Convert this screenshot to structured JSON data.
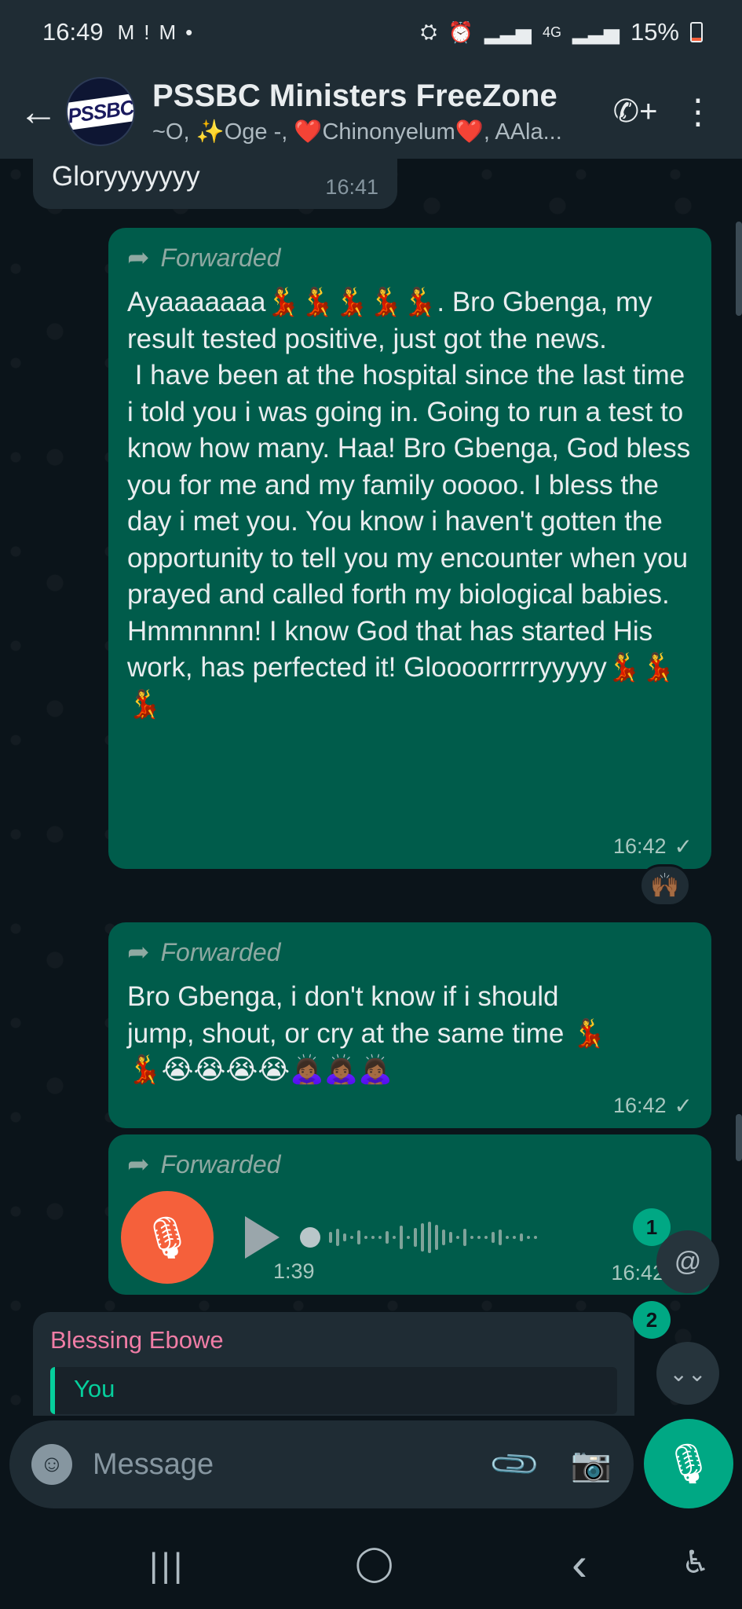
{
  "status_bar": {
    "time": "16:49",
    "left_icons": [
      "M",
      "!",
      "M",
      "•"
    ],
    "signal_label": "4G",
    "battery": "15%"
  },
  "header": {
    "back_icon": "←",
    "avatar_text": "PSSBC",
    "title": "PSSBC Ministers FreeZone",
    "subtitle": "~O, ✨Oge -, ❤️Chinonyelum❤️, AAla...",
    "call_icon": "✆+",
    "menu_icon": "⋮"
  },
  "messages": [
    {
      "direction": "in",
      "text": "Gloryyyyyyy",
      "time": "16:41"
    },
    {
      "direction": "out",
      "forwarded_label": "Forwarded",
      "text": "Ayaaaaaaa💃💃💃💃💃. Bro Gbenga, my result tested positive, just got the news.\n I have been at the hospital since the last time i told you i was going in. Going to run a test to know how many. Haa! Bro Gbenga, God bless you for me and my family ooooo. I bless the day i met you. You know i haven't gotten the opportunity to tell you my encounter when you prayed and called forth my biological babies. Hmmnnnn! I know God that has started His work, has perfected it! Gloooorrrrryyyyy💃💃💃",
      "time": "16:42",
      "status": "✓",
      "reaction": "🙌🏾"
    },
    {
      "direction": "out",
      "forwarded_label": "Forwarded",
      "text": "Bro Gbenga, i don't know if i should jump, shout, or cry at the same time 💃💃😭😭😭😭🙇🏾‍♀️🙇🏾‍♀️🙇🏾‍♀️",
      "time": "16:42",
      "status": "✓"
    },
    {
      "direction": "out",
      "type": "voice",
      "forwarded_label": "Forwarded",
      "duration": "1:39",
      "time": "16:42"
    }
  ],
  "reply_preview": {
    "sender": "Blessing Ebowe",
    "quoted_author": "You"
  },
  "floating": {
    "mention_badge": "1",
    "mention_icon": "@",
    "scroll_badge": "2",
    "scroll_icon": "⌄⌄"
  },
  "composer": {
    "placeholder": "Message",
    "emoji_icon": "☺",
    "attach_icon": "📎",
    "camera_icon": "📷",
    "mic_icon": "🎙"
  },
  "nav": {
    "recents": "|||",
    "home": "◯",
    "back": "‹",
    "accessibility": "♿"
  }
}
